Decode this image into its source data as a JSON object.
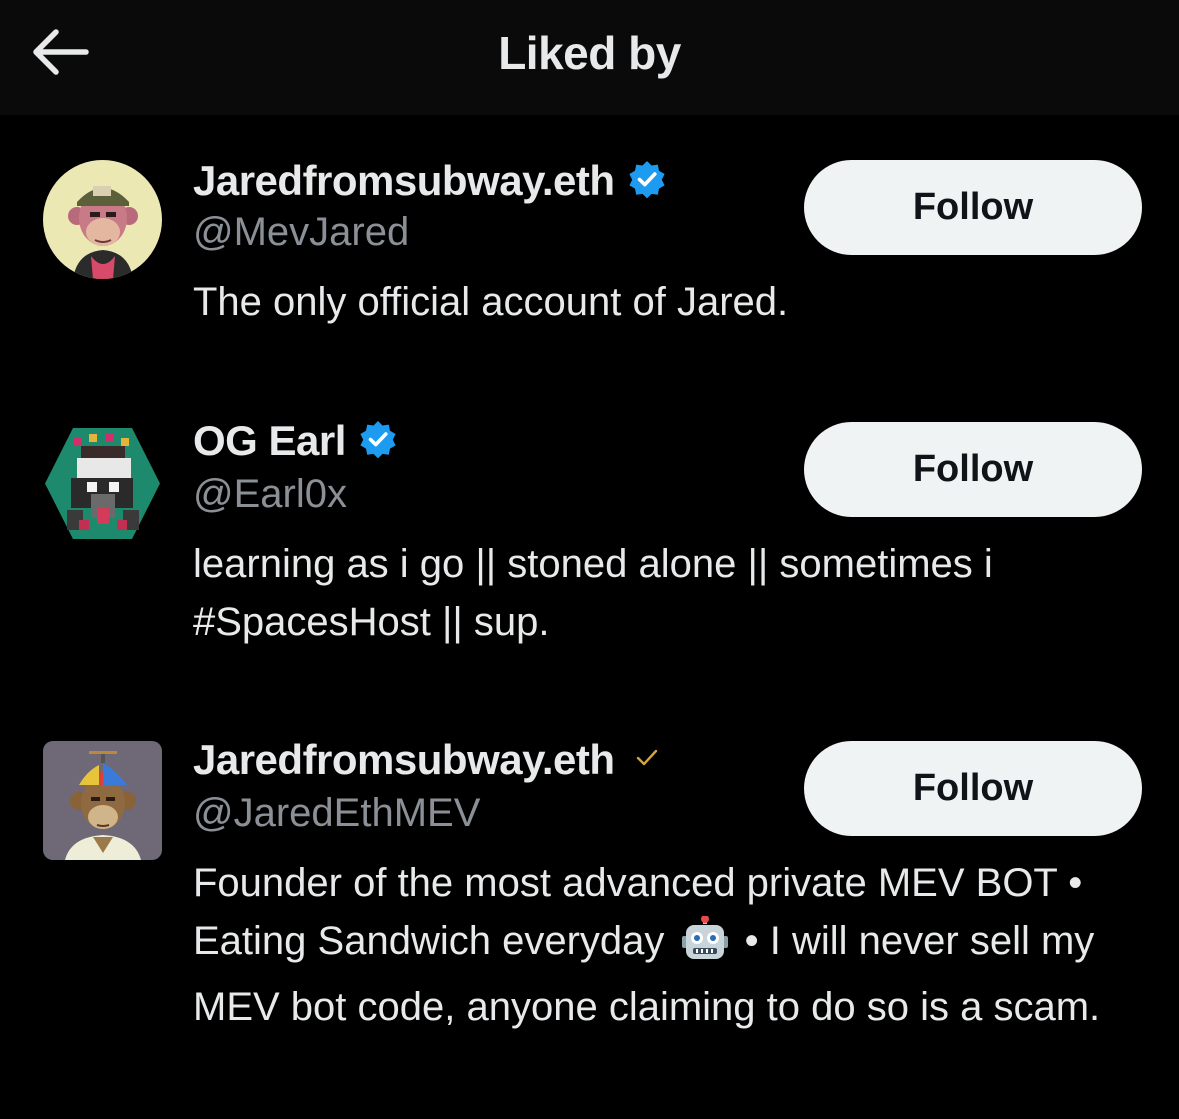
{
  "header": {
    "title": "Liked by",
    "back_icon": "arrow-left-icon"
  },
  "colors": {
    "background": "#000000",
    "header_bg": "#0a0a0a",
    "verified_blue": "#1d9bf0",
    "verified_gold": "#d4a53a",
    "follow_button_bg": "#eff3f4",
    "handle_gray": "#8b9097"
  },
  "users": [
    {
      "display_name": "Jaredfromsubway.eth",
      "handle": "@MevJared",
      "badge": "verified-blue-icon",
      "bio": "The only official account of Jared.",
      "follow_label": "Follow"
    },
    {
      "display_name": "OG Earl",
      "handle": "@Earl0x",
      "badge": "verified-blue-icon",
      "bio_line1": "learning as i go || stoned alone || sometimes i",
      "bio_line2": "#SpacesHost || sup.",
      "follow_label": "Follow"
    },
    {
      "display_name": "Jaredfromsubway.eth",
      "handle": "@JaredEthMEV",
      "badge": "checkmark-gold-icon",
      "bio_part1": "Founder of the most advanced private MEV BOT • Eating Sandwich everyday",
      "bio_emoji": "robot-face-icon",
      "bio_part2": "• I will never sell my MEV bot code, anyone claiming to do so is a scam.",
      "follow_label": "Follow"
    }
  ]
}
